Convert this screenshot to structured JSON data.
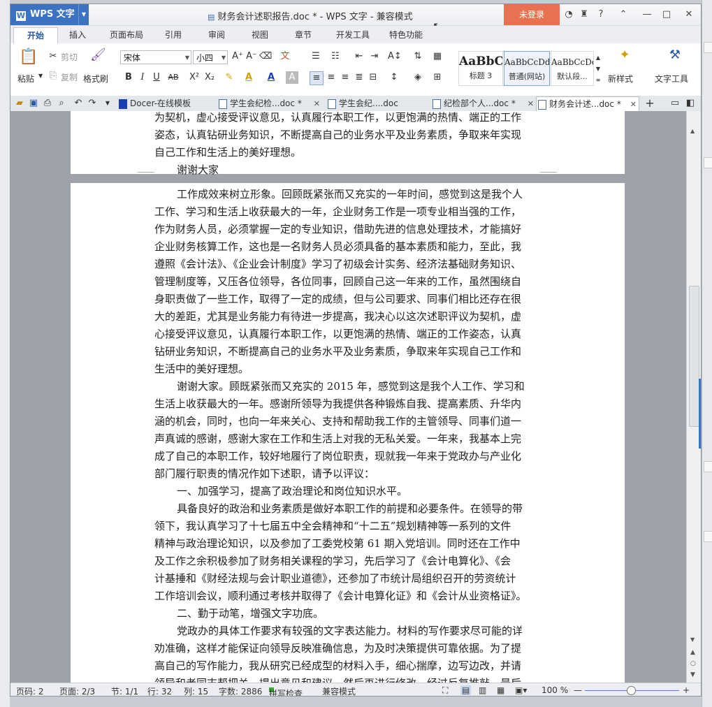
{
  "window": {
    "app_name": "WPS 文字",
    "doc_title": "财务会计述职报告.doc * - WPS 文字 - 兼容模式",
    "login_label": "未登录"
  },
  "tabs": [
    "开始",
    "插入",
    "页面布局",
    "引用",
    "审阅",
    "视图",
    "章节",
    "开发工具",
    "特色功能"
  ],
  "ribbon": {
    "paste": "粘贴",
    "cut": "剪切",
    "copy": "复制",
    "format_painter": "格式刷",
    "font_name": "宋体",
    "font_size": "小四",
    "styles": [
      {
        "preview": "AaBbC",
        "label": "标题 3"
      },
      {
        "preview": "AaBbCcDd",
        "label": "普通(网站)"
      },
      {
        "preview": "AaBbCcDd",
        "label": "默认段..."
      }
    ],
    "new_style": "新样式",
    "text_tools": "文字工具"
  },
  "doc_tabs": [
    {
      "label": "Docer-在线模板",
      "active": false
    },
    {
      "label": "学生会纪检...doc *",
      "active": false
    },
    {
      "label": "学生会纪....doc",
      "active": false
    },
    {
      "label": "纪检部个人...doc *",
      "active": false
    },
    {
      "label": "财务会计述...doc *",
      "active": true
    }
  ],
  "document": {
    "page1_lines": [
      "为契机，虚心接受评议意见，认真履行本职工作，以更饱满的热情、端正的工作",
      "姿态，认真钻研业务知识，不断提高自己的业务水平及业务素质，争取来年实现",
      "自己工作和生活上的美好理想。",
      "谢谢大家"
    ],
    "page2_lines": [
      "工作成效来树立形象。回顾既紧张而又充实的一年时间，感觉到这是我个人",
      "工作、学习和生活上收获最大的一年，企业财务工作是一项专业相当强的工作，",
      "作为财务人员，必须掌握一定的专业知识，借助先进的信息处理技术，才能搞好",
      "企业财务核算工作，这也是一名财务人员必须具备的基本素质和能力，至此，我",
      "遵照《会计法》、《企业会计制度》学习了初级会计实务、经济法基础财务知识、",
      "管理制度等，又压各位领导，各位同事，回顾自己这一年来的工作，虽然围绕自",
      "身职责做了一些工作，取得了一定的成绩，但与公司要求、同事们相比还存在很",
      "大的差距，尤其是业务能力有待进一步提高，我决心以这次述职评议为契机，虚",
      "心接受评议意见，认真履行本职工作，以更饱满的热情、端正的工作姿态，认真",
      "钻研业务知识，不断提高自己的业务水平及业务素质，争取来年实现自己工作和",
      "生活中的美好理想。",
      "谢谢大家。顾既紧张而又充实的 2015 年，感觉到这是我个人工作、学习和",
      "生活上收获最大的一年。感谢所领导为我提供各种锻炼自我、提高素质、升华内",
      "涵的机会，同时，也向一年来关心、支持和帮助我工作的主管领导、同事们道一",
      "声真诚的感谢，感谢大家在工作和生活上对我的无私关爱。一年来，我基本上完",
      "成了自己的本职工作，较好地履行了岗位职责，现就我一年来于党政办与产业化",
      "部门履行职责的情况作如下述职，请予以评议：",
      "一、加强学习，提高了政治理论和岗位知识水平。",
      "具备良好的政治和业务素质是做好本职工作的前提和必要条件。在领导的带",
      "领下，我认真学习了十七届五中全会精神和“十二五”规划精神等一系列的文件",
      "精神与政治理论知识，以及参加了工委党校第 61 期入党培训。同时还在工作中",
      "及工作之余积极参加了财务相关课程的学习，先后学习了《会计电算化》、《会",
      "计基捶和《财经法规与会计职业道德》，还参加了市统计局组织召开的劳资统计",
      "工作培训会议，顺利通过考核并取得了《会计电算化证》和《会计从业资格证》。",
      "二、勤于动笔，增强文字功底。",
      "党政办的具体工作要求有较强的文字表达能力。材料的写作要求尽可能的详",
      "劝准确，这样才能保证向领导反映准确信息，为及时决策提供可靠依据。为了提",
      "高自己的写作能力，我从研究已经成型的材料入手，细心揣摩，边写边改，并请",
      "领导和老同志帮把关，提出意见和建议，然后再进行修改，经过反复推敲，最后"
    ]
  },
  "status": {
    "page_num": "页码: 2",
    "pages": "页面: 2/3",
    "section": "节: 1/1",
    "row": "行: 32",
    "col": "列: 15",
    "word_count": "字数: 2886",
    "spell_check": "拼写检查",
    "compat_mode": "兼容模式",
    "zoom": "100 %"
  }
}
